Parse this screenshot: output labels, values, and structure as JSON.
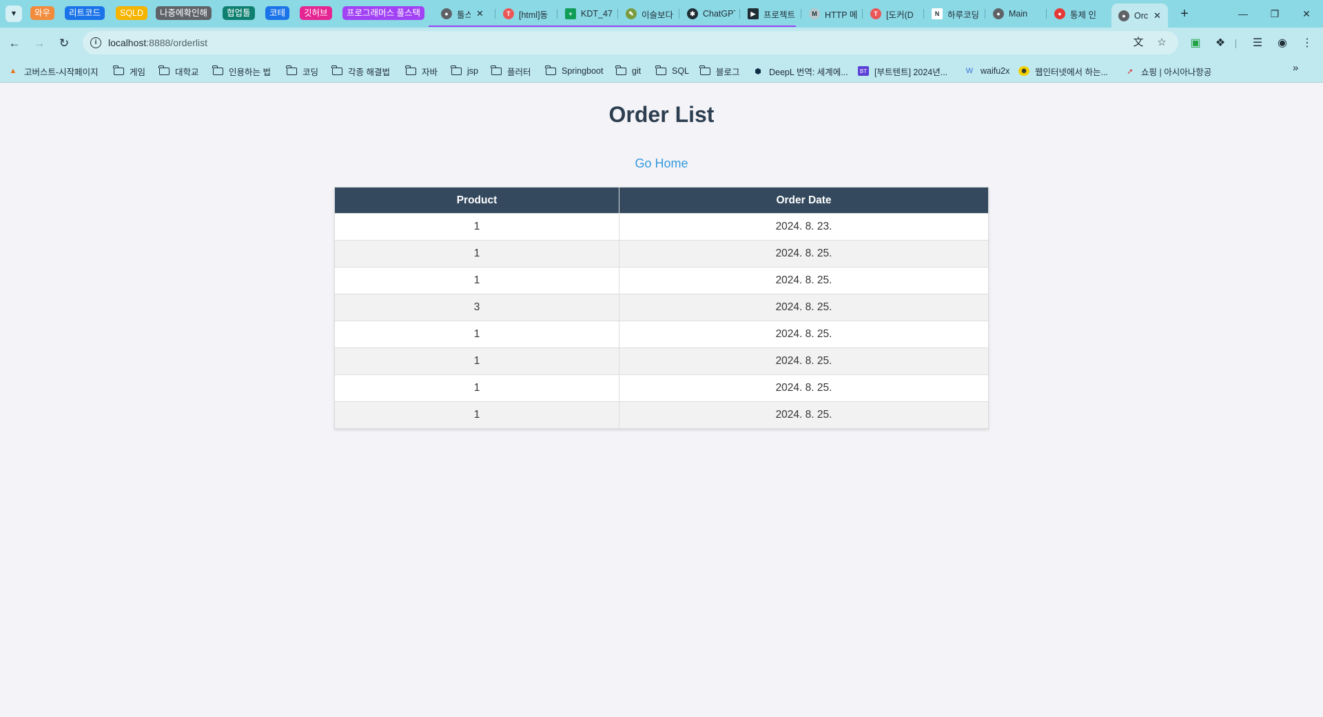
{
  "browser": {
    "tab_groups": [
      {
        "label": "와우",
        "color": "#f28b3c"
      },
      {
        "label": "리트코드",
        "color": "#1a73e8"
      },
      {
        "label": "SQLD",
        "color": "#f5b400"
      },
      {
        "label": "나중에확인해",
        "color": "#5f6368"
      },
      {
        "label": "협업툴",
        "color": "#0f8070"
      },
      {
        "label": "코테",
        "color": "#1a73e8"
      },
      {
        "label": "깃허브",
        "color": "#e52592"
      },
      {
        "label": "프로그래머스 풀스택",
        "color": "#a142f4"
      }
    ],
    "tabs": [
      {
        "title": "툴스",
        "favicon": "globe-icon"
      },
      {
        "title": "[html]동",
        "favicon": "tistory-icon"
      },
      {
        "title": "KDT_47",
        "favicon": "sheets-icon"
      },
      {
        "title": "이슬보다",
        "favicon": "pen-icon"
      },
      {
        "title": "ChatGPT",
        "favicon": "chatgpt-icon"
      },
      {
        "title": "프로젝트",
        "favicon": "jira-icon"
      },
      {
        "title": "HTTP 메",
        "favicon": "mdn-icon"
      },
      {
        "title": "[도커(D",
        "favicon": "tistory-icon"
      },
      {
        "title": "하루코딩",
        "favicon": "notion-icon"
      },
      {
        "title": "Main",
        "favicon": "globe-icon"
      },
      {
        "title": "통제 인",
        "favicon": "pokeball-icon"
      }
    ],
    "active_tab": {
      "title": "Orc",
      "favicon": "globe-icon"
    },
    "url_host": "localhost",
    "url_rest": ":8888/orderlist",
    "bookmarks": [
      {
        "label": "고버스트-시작페이지",
        "icon": "site-icon"
      },
      {
        "label": "게임",
        "icon": "folder-icon"
      },
      {
        "label": "대학교",
        "icon": "folder-icon"
      },
      {
        "label": "인용하는 법",
        "icon": "folder-icon"
      },
      {
        "label": "코딩",
        "icon": "folder-icon"
      },
      {
        "label": "각종 해결법",
        "icon": "folder-icon"
      },
      {
        "label": "자바",
        "icon": "folder-icon"
      },
      {
        "label": "jsp",
        "icon": "folder-icon"
      },
      {
        "label": "플러터",
        "icon": "folder-icon"
      },
      {
        "label": "Springboot",
        "icon": "folder-icon"
      },
      {
        "label": "git",
        "icon": "folder-icon"
      },
      {
        "label": "SQL",
        "icon": "folder-icon"
      },
      {
        "label": "블로그",
        "icon": "folder-icon"
      },
      {
        "label": "DeepL 번역: 세계에...",
        "icon": "deepl-icon"
      },
      {
        "label": "[부트텐트] 2024년...",
        "icon": "bootcamp-icon"
      },
      {
        "label": "waifu2x",
        "icon": "w-icon"
      },
      {
        "label": "웹인터넷에서 하는...",
        "icon": "smile-icon"
      },
      {
        "label": "쇼핑 | 아시아나항공",
        "icon": "asiana-icon"
      }
    ]
  },
  "page": {
    "title": "Order List",
    "home_link": "Go Home",
    "columns": [
      "Product",
      "Order Date"
    ],
    "rows": [
      {
        "product": "1",
        "date": "2024. 8. 23."
      },
      {
        "product": "1",
        "date": "2024. 8. 25."
      },
      {
        "product": "1",
        "date": "2024. 8. 25."
      },
      {
        "product": "3",
        "date": "2024. 8. 25."
      },
      {
        "product": "1",
        "date": "2024. 8. 25."
      },
      {
        "product": "1",
        "date": "2024. 8. 25."
      },
      {
        "product": "1",
        "date": "2024. 8. 25."
      },
      {
        "product": "1",
        "date": "2024. 8. 25."
      }
    ]
  },
  "colors": {
    "header_bg": "#34495e",
    "title": "#2c3e50",
    "link": "#3498db",
    "chrome_frame": "#8cd9e6",
    "chrome_toolbar": "#bfe8ef"
  }
}
